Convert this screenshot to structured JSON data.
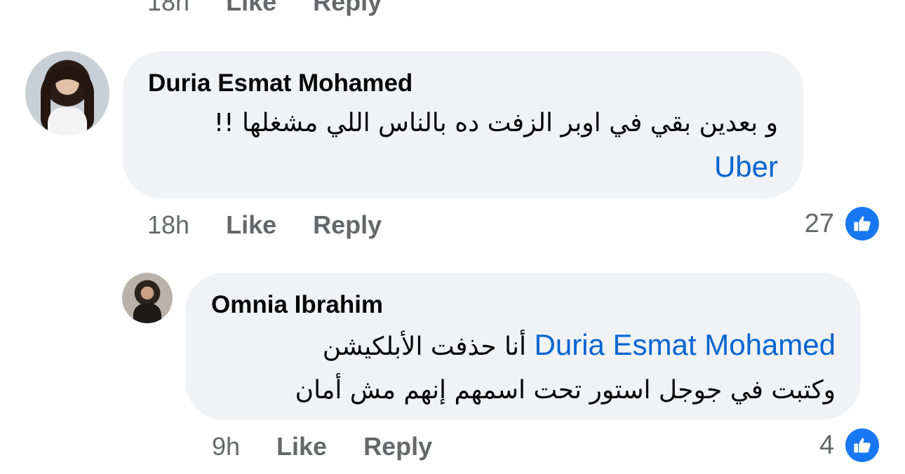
{
  "previous": {
    "time": "18h",
    "like_label": "Like",
    "reply_label": "Reply"
  },
  "comments": [
    {
      "author": "Duria Esmat Mohamed",
      "text_line1": "و بعدين بقي في اوبر الزفت ده بالناس اللي مشغلها !!",
      "mention": "Uber",
      "time": "18h",
      "like_label": "Like",
      "reply_label": "Reply",
      "reaction_count": "27",
      "reaction_icon": "thumbs-up-icon"
    },
    {
      "author": "Omnia Ibrahim",
      "mention": "Duria Esmat Mohamed",
      "text_line1": "أنا حذفت الأبلكيشن",
      "text_line2": "وكتبت في جوجل استور تحت اسمهم إنهم مش أمان",
      "time": "9h",
      "like_label": "Like",
      "reply_label": "Reply",
      "reaction_count": "4",
      "reaction_icon": "thumbs-up-icon"
    }
  ],
  "colors": {
    "bubble": "#f0f2f5",
    "mention": "#0064d1",
    "meta": "#65676b",
    "like_badge": "#1877f2"
  }
}
